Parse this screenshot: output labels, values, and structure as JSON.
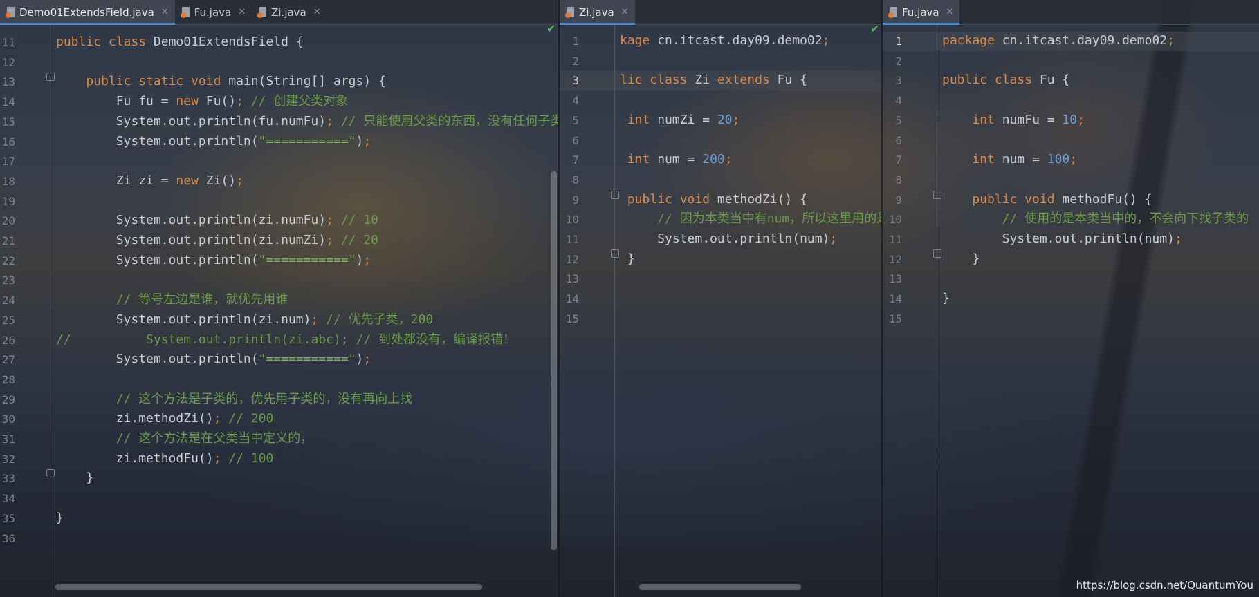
{
  "panes": [
    {
      "tabs": [
        {
          "label": "Demo01ExtendsField.java",
          "active": true
        },
        {
          "label": "Fu.java",
          "active": false
        },
        {
          "label": "Zi.java",
          "active": false
        }
      ],
      "line_numbers": [
        "11",
        "12",
        "13",
        "14",
        "15",
        "16",
        "17",
        "18",
        "19",
        "20",
        "21",
        "22",
        "23",
        "24",
        "25",
        "26",
        "27",
        "28",
        "29",
        "30",
        "31",
        "32",
        "33",
        "34",
        "35",
        "36"
      ],
      "lines": [
        [
          {
            "t": "public class ",
            "c": "kw"
          },
          {
            "t": "Demo01ExtendsField {"
          }
        ],
        [],
        [
          {
            "t": "    "
          },
          {
            "t": "public static void ",
            "c": "kw"
          },
          {
            "t": "main(String[] args) {"
          }
        ],
        [
          {
            "t": "        Fu fu = "
          },
          {
            "t": "new ",
            "c": "kw"
          },
          {
            "t": "Fu()"
          },
          {
            "t": "; ",
            "c": "kw"
          },
          {
            "t": "// 创建父类对象",
            "c": "cmt"
          }
        ],
        [
          {
            "t": "        System.out.println(fu.numFu)"
          },
          {
            "t": "; ",
            "c": "kw"
          },
          {
            "t": "// 只能使用父类的东西，没有任何子类",
            "c": "cmt"
          }
        ],
        [
          {
            "t": "        System.out.println("
          },
          {
            "t": "\"===========\"",
            "c": "str"
          },
          {
            "t": ")"
          },
          {
            "t": ";",
            "c": "kw"
          }
        ],
        [],
        [
          {
            "t": "        Zi zi = "
          },
          {
            "t": "new ",
            "c": "kw"
          },
          {
            "t": "Zi()"
          },
          {
            "t": ";",
            "c": "kw"
          }
        ],
        [],
        [
          {
            "t": "        System.out.println(zi.numFu)"
          },
          {
            "t": "; ",
            "c": "kw"
          },
          {
            "t": "// 10",
            "c": "cmt"
          }
        ],
        [
          {
            "t": "        System.out.println(zi.numZi)"
          },
          {
            "t": "; ",
            "c": "kw"
          },
          {
            "t": "// 20",
            "c": "cmt"
          }
        ],
        [
          {
            "t": "        System.out.println("
          },
          {
            "t": "\"===========\"",
            "c": "str"
          },
          {
            "t": ")"
          },
          {
            "t": ";",
            "c": "kw"
          }
        ],
        [],
        [
          {
            "t": "        "
          },
          {
            "t": "// 等号左边是谁，就优先用谁",
            "c": "cmt"
          }
        ],
        [
          {
            "t": "        System.out.println(zi.num)"
          },
          {
            "t": "; ",
            "c": "kw"
          },
          {
            "t": "// 优先子类，200",
            "c": "cmt"
          }
        ],
        [
          {
            "t": "//          System.out.println(zi.abc); // 到处都没有，编译报错！",
            "c": "cmt"
          }
        ],
        [
          {
            "t": "        System.out.println("
          },
          {
            "t": "\"===========\"",
            "c": "str"
          },
          {
            "t": ")"
          },
          {
            "t": ";",
            "c": "kw"
          }
        ],
        [],
        [
          {
            "t": "        "
          },
          {
            "t": "// 这个方法是子类的，优先用子类的，没有再向上找",
            "c": "cmt"
          }
        ],
        [
          {
            "t": "        zi.methodZi()"
          },
          {
            "t": "; ",
            "c": "kw"
          },
          {
            "t": "// 200",
            "c": "cmt"
          }
        ],
        [
          {
            "t": "        "
          },
          {
            "t": "// 这个方法是在父类当中定义的，",
            "c": "cmt"
          }
        ],
        [
          {
            "t": "        zi.methodFu()"
          },
          {
            "t": "; ",
            "c": "kw"
          },
          {
            "t": "// 100",
            "c": "cmt"
          }
        ],
        [
          {
            "t": "    }"
          }
        ],
        [],
        [
          {
            "t": "}"
          }
        ],
        []
      ]
    },
    {
      "tabs": [
        {
          "label": "Zi.java",
          "active": true
        }
      ],
      "line_numbers": [
        "1",
        "2",
        "3",
        "4",
        "5",
        "6",
        "7",
        "8",
        "9",
        "10",
        "11",
        "12",
        "13",
        "14",
        "15"
      ],
      "current_line": "3",
      "lines": [
        [
          {
            "t": "kage ",
            "c": "kw"
          },
          {
            "t": "cn.itcast.day09.demo02"
          },
          {
            "t": ";",
            "c": "kw"
          }
        ],
        [],
        [
          {
            "t": "lic class ",
            "c": "kw"
          },
          {
            "t": "Zi "
          },
          {
            "t": "extends ",
            "c": "kw"
          },
          {
            "t": "Fu {"
          }
        ],
        [],
        [
          {
            "t": " "
          },
          {
            "t": "int ",
            "c": "kw"
          },
          {
            "t": "numZi = "
          },
          {
            "t": "20",
            "c": "num"
          },
          {
            "t": ";",
            "c": "kw"
          }
        ],
        [],
        [
          {
            "t": " "
          },
          {
            "t": "int ",
            "c": "kw"
          },
          {
            "t": "num = "
          },
          {
            "t": "200",
            "c": "num"
          },
          {
            "t": ";",
            "c": "kw"
          }
        ],
        [],
        [
          {
            "t": " "
          },
          {
            "t": "public void ",
            "c": "kw"
          },
          {
            "t": "methodZi() {"
          }
        ],
        [
          {
            "t": "     "
          },
          {
            "t": "// 因为本类当中有num，所以这里用的是",
            "c": "cmt"
          }
        ],
        [
          {
            "t": "     System.out.println(num)"
          },
          {
            "t": ";",
            "c": "kw"
          }
        ],
        [
          {
            "t": " }"
          }
        ],
        [],
        [],
        []
      ]
    },
    {
      "tabs": [
        {
          "label": "Fu.java",
          "active": true
        }
      ],
      "line_numbers": [
        "1",
        "2",
        "3",
        "4",
        "5",
        "6",
        "7",
        "8",
        "9",
        "10",
        "11",
        "12",
        "13",
        "14",
        "15"
      ],
      "current_line": "1",
      "lines": [
        [
          {
            "t": "package ",
            "c": "kw"
          },
          {
            "t": "cn.itcast.day09.demo02"
          },
          {
            "t": ";",
            "c": "kw"
          }
        ],
        [],
        [
          {
            "t": "public class ",
            "c": "kw"
          },
          {
            "t": "Fu {"
          }
        ],
        [],
        [
          {
            "t": "    "
          },
          {
            "t": "int ",
            "c": "kw"
          },
          {
            "t": "numFu = "
          },
          {
            "t": "10",
            "c": "num"
          },
          {
            "t": ";",
            "c": "kw"
          }
        ],
        [],
        [
          {
            "t": "    "
          },
          {
            "t": "int ",
            "c": "kw"
          },
          {
            "t": "num = "
          },
          {
            "t": "100",
            "c": "num"
          },
          {
            "t": ";",
            "c": "kw"
          }
        ],
        [],
        [
          {
            "t": "    "
          },
          {
            "t": "public void ",
            "c": "kw"
          },
          {
            "t": "methodFu() {"
          }
        ],
        [
          {
            "t": "        "
          },
          {
            "t": "// 使用的是本类当中的，不会向下找子类的",
            "c": "cmt"
          }
        ],
        [
          {
            "t": "        System.out.println(num)"
          },
          {
            "t": ";",
            "c": "kw"
          }
        ],
        [
          {
            "t": "    }"
          }
        ],
        [],
        [
          {
            "t": "}"
          }
        ],
        []
      ]
    }
  ],
  "watermark": "https://blog.csdn.net/QuantumYou",
  "colors": {
    "keyword": "#d78b4a",
    "number": "#6f9fd8",
    "string": "#7fae63",
    "comment": "#6a9a4a",
    "accent": "#4a88c7"
  },
  "icons": {
    "file": "java-file-icon",
    "close": "close-icon",
    "check": "check-icon",
    "fold": "fold-marker-icon"
  }
}
